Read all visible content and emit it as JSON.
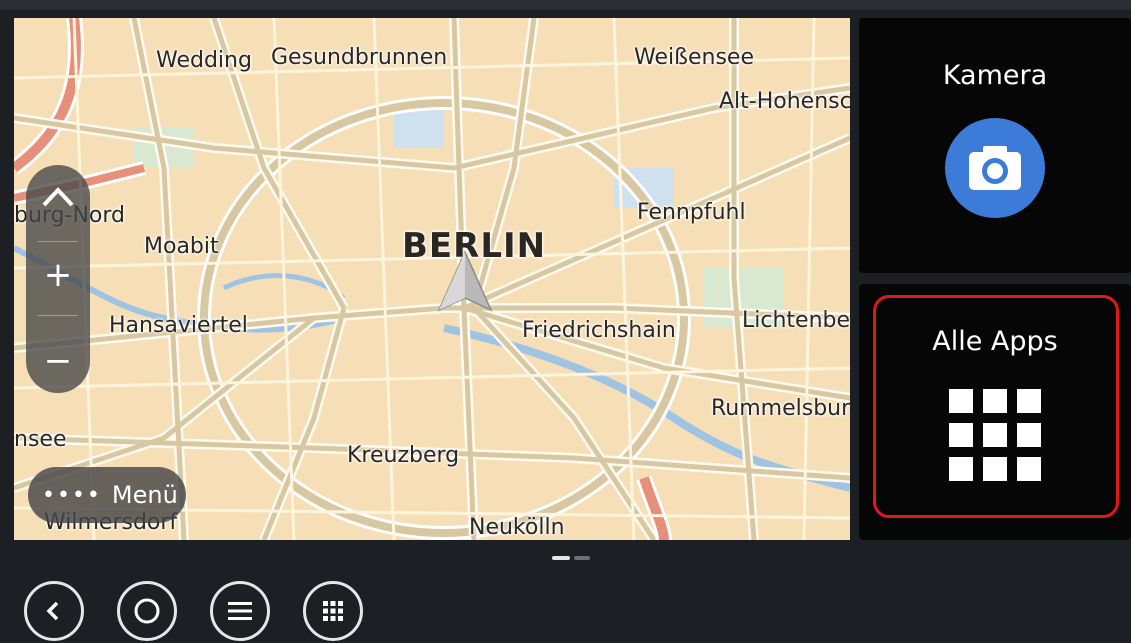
{
  "map": {
    "city_label": "BERLIN",
    "districts": [
      "Wedding",
      "Gesundbrunnen",
      "Weißensee",
      "Alt-Hohensc",
      "burg-Nord",
      "Moabit",
      "Fennpfuhl",
      "Hansaviertel",
      "Friedrichshain",
      "Lichtenbe",
      "Rummelsburg",
      "nsee",
      "Kreuzberg",
      "Wilmersdorf",
      "Neukölln"
    ]
  },
  "zoom": {
    "up_icon": "chevron-up-icon",
    "zoom_in": "+",
    "zoom_out": "−"
  },
  "menu": {
    "dots": "••••",
    "label": "Menü"
  },
  "cards": {
    "camera": {
      "title": "Kamera",
      "icon": "camera-icon",
      "accent": "#3d7bd9"
    },
    "all_apps": {
      "title": "Alle Apps",
      "icon": "apps-grid-icon"
    }
  },
  "highlight_color": "#e0171b",
  "nav": [
    {
      "name": "back-icon"
    },
    {
      "name": "home-icon"
    },
    {
      "name": "menu-icon"
    },
    {
      "name": "apps-icon"
    }
  ]
}
